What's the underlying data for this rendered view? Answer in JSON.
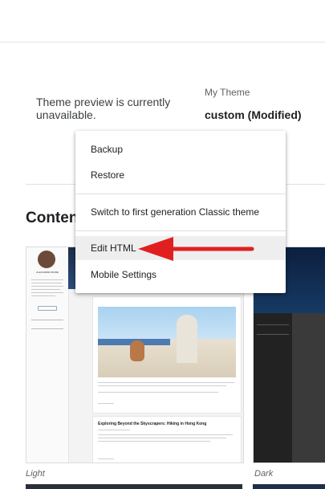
{
  "preview": {
    "message": "Theme preview is currently unavailable."
  },
  "current_theme": {
    "label": "My Theme",
    "name": "custom (Modified)"
  },
  "section": {
    "title": "Content"
  },
  "themes": [
    {
      "label": "Light",
      "preview": {
        "author": "ALEXANDRA MORE",
        "post1_title": "",
        "post2_title": "Exploring Beyond the Skyscrapers: Hiking in Hong Kong"
      }
    },
    {
      "label": "Dark"
    }
  ],
  "menu": {
    "items": [
      {
        "label": "Backup"
      },
      {
        "label": "Restore"
      },
      {
        "label": "Switch to first generation Classic theme"
      },
      {
        "label": "Edit HTML"
      },
      {
        "label": "Mobile Settings"
      }
    ]
  },
  "colors": {
    "annotation_arrow": "#e02020",
    "accent_red": "#d93025"
  }
}
